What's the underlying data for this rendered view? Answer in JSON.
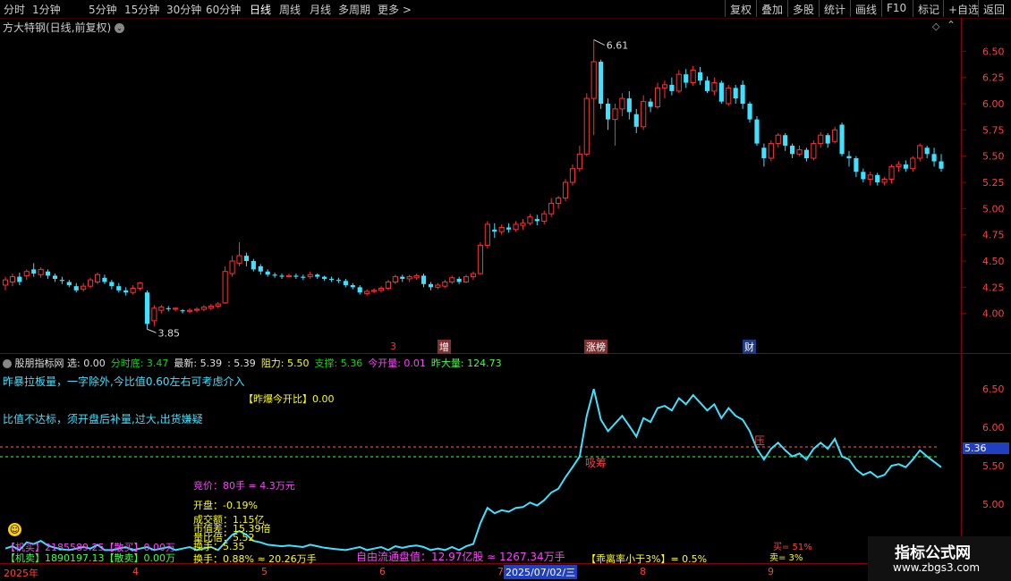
{
  "toolbar": {
    "periods": [
      "分时",
      "1分钟",
      "5分钟",
      "15分钟",
      "30分钟",
      "60分钟",
      "日线",
      "周线",
      "月线",
      "多周期",
      "更多 >"
    ],
    "active_period": "日线",
    "right_buttons": [
      "复权",
      "叠加",
      "多股",
      "统计",
      "画线",
      "F10",
      "标记",
      "+自选",
      "返回"
    ]
  },
  "stock": {
    "title": "方大特钢(日线,前复权)",
    "high_label": "6.61",
    "low_label": "3.85"
  },
  "price_axis": [
    "6.50",
    "6.25",
    "6.00",
    "5.75",
    "5.50",
    "5.25",
    "5.00",
    "4.75",
    "4.50",
    "4.25",
    "4.00"
  ],
  "event_markers": [
    {
      "label": "3",
      "type": "red"
    },
    {
      "label": "增",
      "type": "bg"
    },
    {
      "label": "涨榜",
      "type": "bg"
    },
    {
      "label": "财",
      "type": "blue"
    }
  ],
  "indicator": {
    "header": [
      {
        "k": "name",
        "text": "股朋指标网 选: 0.00",
        "color": "#e0e0e0"
      },
      {
        "k": "fsd",
        "text": "分时底: 3.47",
        "color": "#00e000"
      },
      {
        "k": "new",
        "text": "最新: 5.39",
        "color": "#e0e0e0"
      },
      {
        "k": "v539",
        "text": ": 5.39",
        "color": "#e0e0e0"
      },
      {
        "k": "zl",
        "text": "阻力: 5.50",
        "color": "#ffff00"
      },
      {
        "k": "zc",
        "text": "支撑: 5.36",
        "color": "#00e000"
      },
      {
        "k": "jkl",
        "text": "今开量: 0.01",
        "color": "#ff40ff"
      },
      {
        "k": "zdl",
        "text": "昨大量: 124.73",
        "color": "#40ff40"
      }
    ],
    "line1": "昨暴拉板量，一字除外,今比值0.60左右可考虑介入",
    "ratio": "【昨爆今开比】0.00",
    "line2": "比值不达标，须开盘后补量,过大,出货嫌疑",
    "bid": "竞价：80手 = 4.3万元",
    "open": "开盘：-0.19%",
    "stack": [
      "成交额：1.15亿",
      "市值差：15.39倍",
      "量比倍：5.52",
      "换手：5.35"
    ],
    "turnover": "换手：0.88% ≈ 20.26万手",
    "free_float": "自由流通盘值：12.97亿股 ≈ 1267.34万手",
    "deviation": "【乖离率小于3%】= 0.5%",
    "buy_pct": "买= 51%",
    "sell_pct": "卖= 3%",
    "ya_label": "压",
    "xichou_label": "吸筹",
    "value_tag": "5.36",
    "main_buy": "【机买】2185589.25【散买】0.00万",
    "main_sell": "【机卖】1890197.13【散卖】0.00万",
    "axis": [
      "6.50",
      "6.00",
      "5.50",
      "5.00",
      "4.50"
    ]
  },
  "date_axis": [
    "2025年",
    "4",
    "5",
    "6",
    "7",
    "2025/07/02/三",
    "8",
    "9"
  ],
  "watermark": {
    "title": "指标公式网",
    "url": "www.zbgs3.com"
  },
  "chart_data": {
    "type": "candlestick",
    "title": "方大特钢(日线,前复权)",
    "ylim": [
      3.75,
      6.75
    ],
    "high_marker": 6.61,
    "low_marker": 3.85,
    "candles": [
      [
        4.27,
        4.32,
        4.22,
        4.35
      ],
      [
        4.3,
        4.35,
        4.26,
        4.38
      ],
      [
        4.35,
        4.3,
        4.27,
        4.39
      ],
      [
        4.36,
        4.4,
        4.32,
        4.42
      ],
      [
        4.42,
        4.38,
        4.35,
        4.48
      ],
      [
        4.37,
        4.42,
        4.34,
        4.44
      ],
      [
        4.4,
        4.36,
        4.33,
        4.42
      ],
      [
        4.36,
        4.33,
        4.3,
        4.38
      ],
      [
        4.32,
        4.31,
        4.28,
        4.35
      ],
      [
        4.3,
        4.27,
        4.25,
        4.32
      ],
      [
        4.26,
        4.22,
        4.2,
        4.29
      ],
      [
        4.23,
        4.26,
        4.21,
        4.29
      ],
      [
        4.26,
        4.32,
        4.24,
        4.34
      ],
      [
        4.3,
        4.37,
        4.28,
        4.39
      ],
      [
        4.34,
        4.3,
        4.28,
        4.37
      ],
      [
        4.3,
        4.26,
        4.23,
        4.32
      ],
      [
        4.26,
        4.22,
        4.2,
        4.29
      ],
      [
        4.22,
        4.2,
        4.17,
        4.25
      ],
      [
        4.2,
        4.24,
        4.18,
        4.27
      ],
      [
        4.24,
        4.29,
        4.22,
        4.3
      ],
      [
        4.2,
        3.9,
        3.85,
        4.22
      ],
      [
        3.93,
        4.05,
        3.88,
        4.08
      ],
      [
        4.03,
        4.06,
        4.0,
        4.08
      ],
      [
        4.05,
        4.04,
        4.02,
        4.07
      ],
      [
        4.04,
        4.05,
        4.02,
        4.06
      ],
      [
        4.03,
        4.02,
        4.0,
        4.04
      ],
      [
        4.02,
        4.03,
        4.0,
        4.05
      ],
      [
        4.03,
        4.04,
        4.01,
        4.06
      ],
      [
        4.04,
        4.06,
        4.02,
        4.08
      ],
      [
        4.05,
        4.07,
        4.03,
        4.09
      ],
      [
        4.07,
        4.09,
        4.05,
        4.11
      ],
      [
        4.1,
        4.4,
        4.09,
        4.45
      ],
      [
        4.38,
        4.5,
        4.35,
        4.55
      ],
      [
        4.48,
        4.55,
        4.45,
        4.68
      ],
      [
        4.55,
        4.5,
        4.45,
        4.58
      ],
      [
        4.5,
        4.42,
        4.4,
        4.52
      ],
      [
        4.45,
        4.4,
        4.37,
        4.47
      ],
      [
        4.4,
        4.37,
        4.35,
        4.42
      ],
      [
        4.37,
        4.36,
        4.34,
        4.39
      ],
      [
        4.36,
        4.35,
        4.33,
        4.38
      ],
      [
        4.35,
        4.36,
        4.34,
        4.38
      ],
      [
        4.36,
        4.35,
        4.33,
        4.38
      ],
      [
        4.35,
        4.34,
        4.32,
        4.37
      ],
      [
        4.35,
        4.37,
        4.33,
        4.4
      ],
      [
        4.37,
        4.35,
        4.33,
        4.38
      ],
      [
        4.35,
        4.33,
        4.31,
        4.36
      ],
      [
        4.33,
        4.32,
        4.3,
        4.35
      ],
      [
        4.32,
        4.31,
        4.29,
        4.34
      ],
      [
        4.31,
        4.27,
        4.25,
        4.33
      ],
      [
        4.27,
        4.25,
        4.23,
        4.29
      ],
      [
        4.25,
        4.2,
        4.18,
        4.27
      ],
      [
        4.19,
        4.21,
        4.17,
        4.23
      ],
      [
        4.21,
        4.22,
        4.19,
        4.24
      ],
      [
        4.22,
        4.24,
        4.2,
        4.26
      ],
      [
        4.24,
        4.3,
        4.22,
        4.32
      ],
      [
        4.3,
        4.35,
        4.28,
        4.37
      ],
      [
        4.35,
        4.33,
        4.3,
        4.37
      ],
      [
        4.33,
        4.35,
        4.3,
        4.37
      ],
      [
        4.34,
        4.36,
        4.32,
        4.38
      ],
      [
        4.36,
        4.28,
        4.25,
        4.38
      ],
      [
        4.28,
        4.25,
        4.22,
        4.3
      ],
      [
        4.25,
        4.27,
        4.23,
        4.29
      ],
      [
        4.26,
        4.3,
        4.24,
        4.32
      ],
      [
        4.3,
        4.34,
        4.28,
        4.36
      ],
      [
        4.33,
        4.3,
        4.28,
        4.35
      ],
      [
        4.3,
        4.35,
        4.29,
        4.37
      ],
      [
        4.35,
        4.38,
        4.32,
        4.4
      ],
      [
        4.38,
        4.65,
        4.37,
        4.68
      ],
      [
        4.65,
        4.85,
        4.62,
        4.88
      ],
      [
        4.8,
        4.78,
        4.72,
        4.86
      ],
      [
        4.78,
        4.82,
        4.75,
        4.85
      ],
      [
        4.82,
        4.8,
        4.77,
        4.86
      ],
      [
        4.8,
        4.85,
        4.78,
        4.88
      ],
      [
        4.84,
        4.86,
        4.8,
        4.9
      ],
      [
        4.86,
        4.92,
        4.84,
        4.95
      ],
      [
        4.9,
        4.88,
        4.84,
        4.94
      ],
      [
        4.88,
        4.95,
        4.85,
        4.98
      ],
      [
        4.95,
        5.05,
        4.92,
        5.1
      ],
      [
        5.05,
        5.1,
        5.0,
        5.12
      ],
      [
        5.1,
        5.25,
        5.07,
        5.28
      ],
      [
        5.25,
        5.38,
        5.22,
        5.42
      ],
      [
        5.38,
        5.52,
        5.35,
        5.6
      ],
      [
        5.52,
        6.05,
        5.5,
        6.1
      ],
      [
        6.05,
        6.4,
        5.7,
        6.61
      ],
      [
        6.4,
        6.0,
        5.95,
        6.42
      ],
      [
        6.0,
        5.85,
        5.75,
        6.05
      ],
      [
        5.85,
        5.95,
        5.6,
        6.0
      ],
      [
        5.95,
        6.05,
        5.88,
        6.1
      ],
      [
        6.05,
        5.92,
        5.85,
        6.12
      ],
      [
        5.9,
        5.78,
        5.72,
        5.95
      ],
      [
        5.78,
        6.02,
        5.75,
        6.08
      ],
      [
        6.02,
        5.97,
        5.92,
        6.05
      ],
      [
        5.97,
        6.15,
        5.95,
        6.2
      ],
      [
        6.15,
        6.18,
        6.05,
        6.22
      ],
      [
        6.18,
        6.12,
        6.08,
        6.25
      ],
      [
        6.12,
        6.28,
        6.1,
        6.32
      ],
      [
        6.28,
        6.2,
        6.15,
        6.33
      ],
      [
        6.2,
        6.32,
        6.17,
        6.36
      ],
      [
        6.3,
        6.22,
        6.18,
        6.35
      ],
      [
        6.22,
        6.12,
        6.1,
        6.26
      ],
      [
        6.12,
        6.2,
        6.08,
        6.25
      ],
      [
        6.2,
        6.02,
        6.0,
        6.22
      ],
      [
        6.0,
        6.15,
        5.98,
        6.18
      ],
      [
        6.15,
        6.05,
        6.0,
        6.18
      ],
      [
        6.18,
        6.0,
        5.95,
        6.22
      ],
      [
        6.0,
        5.85,
        5.82,
        6.02
      ],
      [
        5.85,
        5.62,
        5.6,
        5.88
      ],
      [
        5.58,
        5.48,
        5.4,
        5.62
      ],
      [
        5.48,
        5.62,
        5.45,
        5.65
      ],
      [
        5.62,
        5.7,
        5.58,
        5.72
      ],
      [
        5.7,
        5.6,
        5.55,
        5.72
      ],
      [
        5.6,
        5.52,
        5.48,
        5.62
      ],
      [
        5.52,
        5.56,
        5.5,
        5.6
      ],
      [
        5.56,
        5.48,
        5.45,
        5.58
      ],
      [
        5.48,
        5.62,
        5.46,
        5.65
      ],
      [
        5.62,
        5.7,
        5.58,
        5.73
      ],
      [
        5.7,
        5.62,
        5.58,
        5.72
      ],
      [
        5.64,
        5.75,
        5.62,
        5.78
      ],
      [
        5.8,
        5.52,
        5.5,
        5.82
      ],
      [
        5.5,
        5.48,
        5.4,
        5.55
      ],
      [
        5.48,
        5.35,
        5.3,
        5.5
      ],
      [
        5.35,
        5.28,
        5.25,
        5.38
      ],
      [
        5.28,
        5.32,
        5.22,
        5.35
      ],
      [
        5.32,
        5.25,
        5.22,
        5.34
      ],
      [
        5.25,
        5.28,
        5.22,
        5.3
      ],
      [
        5.28,
        5.4,
        5.24,
        5.42
      ],
      [
        5.4,
        5.42,
        5.35,
        5.45
      ],
      [
        5.42,
        5.38,
        5.35,
        5.46
      ],
      [
        5.38,
        5.48,
        5.35,
        5.5
      ],
      [
        5.48,
        5.6,
        5.45,
        5.62
      ],
      [
        5.58,
        5.52,
        5.48,
        5.6
      ],
      [
        5.52,
        5.45,
        5.4,
        5.58
      ],
      [
        5.45,
        5.38,
        5.35,
        5.52
      ]
    ]
  }
}
